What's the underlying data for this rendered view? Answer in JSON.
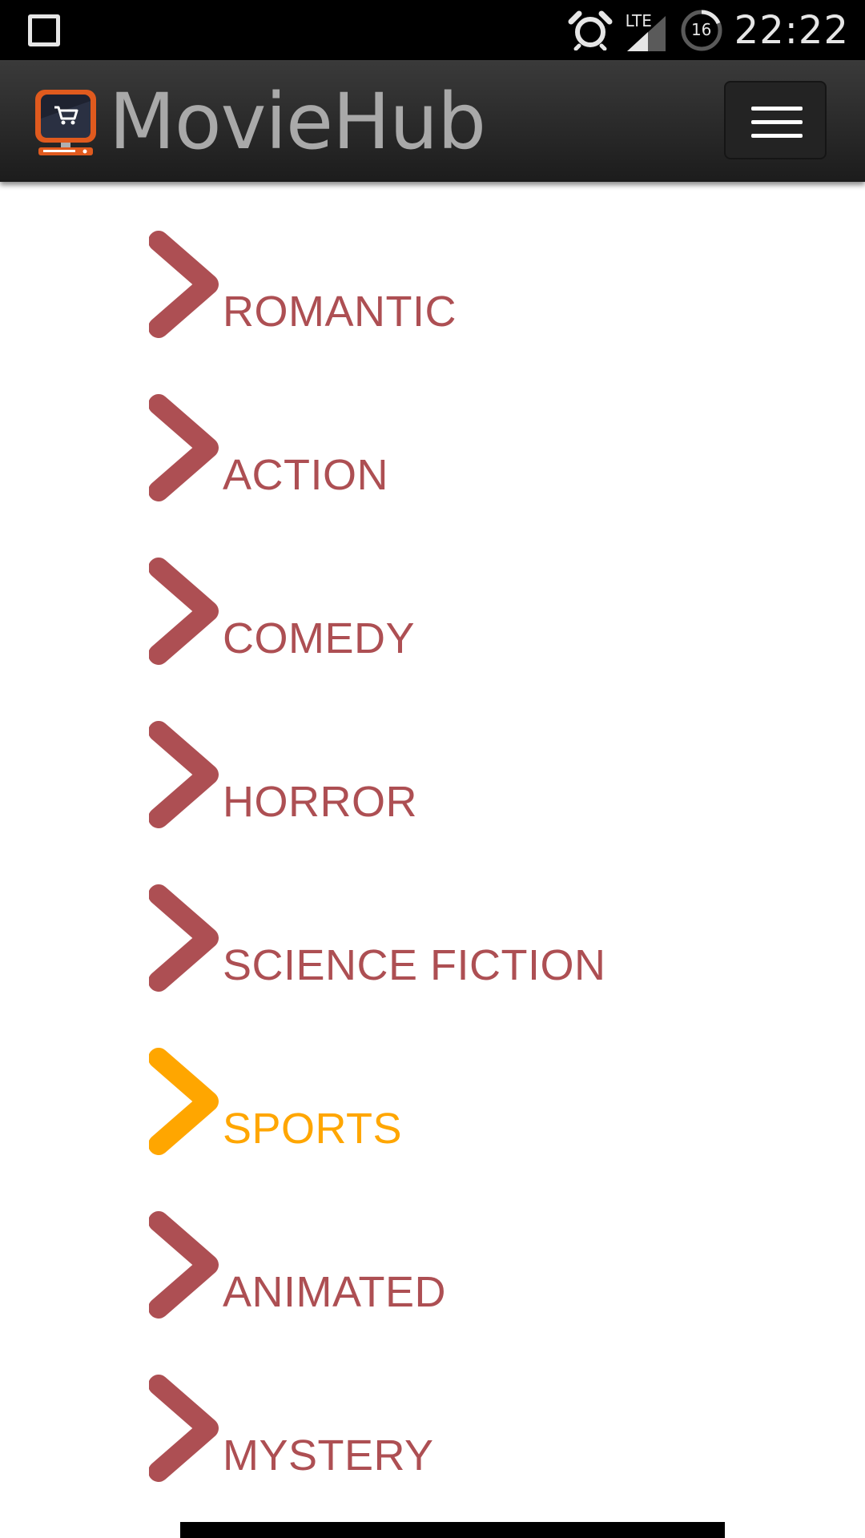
{
  "statusbar": {
    "network": "LTE",
    "battery": "16",
    "time": "22:22"
  },
  "appbar": {
    "title": "MovieHub"
  },
  "colors": {
    "item": "#ad4f53",
    "active": "#ffa600"
  },
  "categories": [
    {
      "label": "ROMANTIC"
    },
    {
      "label": "ACTION"
    },
    {
      "label": "COMEDY"
    },
    {
      "label": "HORROR"
    },
    {
      "label": "SCIENCE FICTION"
    },
    {
      "label": "SPORTS",
      "active": true
    },
    {
      "label": "ANIMATED"
    },
    {
      "label": "MYSTERY"
    }
  ]
}
